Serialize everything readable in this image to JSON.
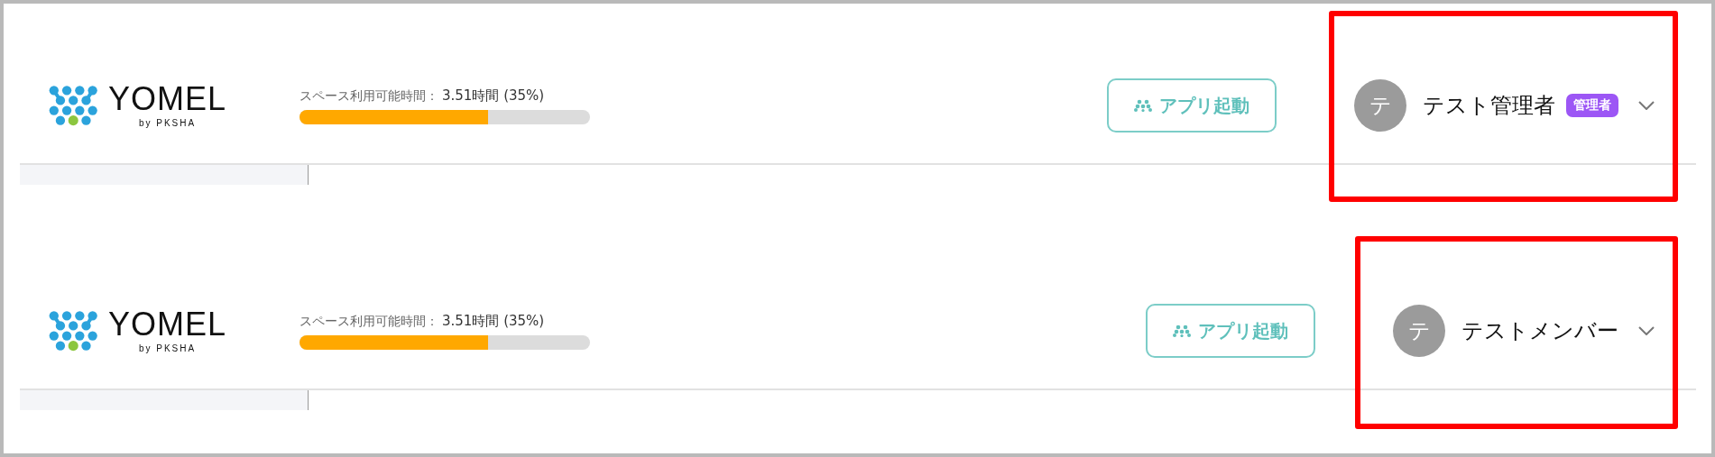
{
  "headers": [
    {
      "logo": {
        "wordmark": "YOMEL",
        "byline": "by PKSHA"
      },
      "space": {
        "label": "スペース利用可能時間：",
        "value": "3.51時間 (35%)",
        "level": 0.65
      },
      "launch_button": "アプリ起動",
      "user": {
        "initial": "テ",
        "name": "テスト管理者",
        "badge": "管理者"
      },
      "highlighted": true
    },
    {
      "logo": {
        "wordmark": "YOMEL",
        "byline": "by PKSHA"
      },
      "space": {
        "label": "スペース利用可能時間：",
        "value": "3.51時間 (35%)",
        "level": 0.65
      },
      "launch_button": "アプリ起動",
      "user": {
        "initial": "テ",
        "name": "テストメンバー"
      },
      "highlighted": true
    }
  ]
}
